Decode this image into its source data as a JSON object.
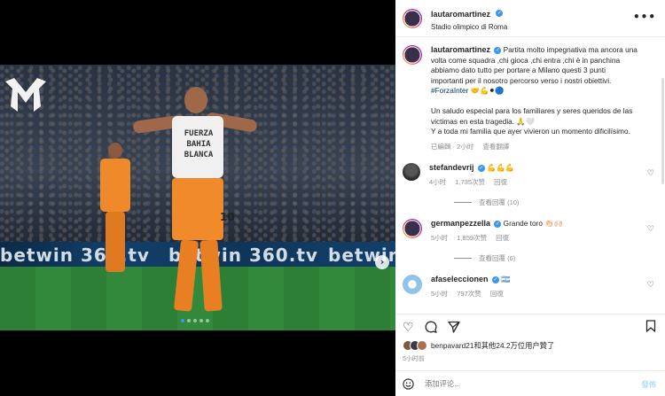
{
  "post": {
    "author": "lautaromartinez",
    "location": "Stadio olimpico di Roma",
    "caption_lines": [
      "Partita molto impegnativa ma ancora una",
      "volta come squadra ,chi gioca ,chi entra ,chi è in panchina",
      "abbiamo dato tutto per portare a Milano questi 3 punti",
      "importanti per il nosotro percorso verso i nostri obiettivi."
    ],
    "hashtag": "#ForzaInter",
    "hashtag_emojis": "🤝💪⚫🔵",
    "caption_es_lines": [
      "Un saludo especial para los familiares y seres queridos de las",
      "victimas en esta tragedia. 🙏🤍",
      "Y a toda mi familia que ayer vivieron un momento dificilísimo."
    ],
    "edited": "已編輯 · 2小时",
    "translate": "查看翻譯",
    "media": {
      "shirt_text": "FUERZA\nBAHIA BLANCA",
      "shirt_number": "10",
      "board_texts": [
        "betwin 360.tv",
        "betwin 360.tv",
        "betwin"
      ],
      "logo_text": "M",
      "next": "›",
      "slide_count": 5,
      "active_slide": 1
    }
  },
  "comments": [
    {
      "user": "stefandevrij",
      "verified": true,
      "text": "💪💪💪",
      "time": "4小时",
      "likes": "1,735次赞",
      "reply": "回復",
      "replies": "查看回覆 (10)"
    },
    {
      "user": "germanpezzella",
      "verified": true,
      "text": "Grande toro 👏🏻🙌🏻",
      "time": "5小时",
      "likes": "1,859次赞",
      "reply": "回復",
      "replies": "查看回覆 (6)"
    },
    {
      "user": "afaseleccionen",
      "verified": true,
      "text": "🇦🇷",
      "time": "5小时",
      "likes": "797次赞",
      "reply": "回復",
      "replies": ""
    }
  ],
  "likes": {
    "text": "benpavard21和其他24.2万位用户贊了",
    "time": "5小时前"
  },
  "composer": {
    "placeholder": "添加评论...",
    "post_label": "發佈"
  },
  "icons": {
    "more": "more-icon",
    "heart": "heart-icon",
    "comment": "comment-icon",
    "share": "share-icon",
    "bookmark": "bookmark-icon",
    "emoji": "emoji-icon"
  },
  "colors": {
    "link": "#00376b",
    "verified": "#3897f0",
    "muted": "#8e8e8e",
    "post_disabled": "#b2dffc"
  }
}
